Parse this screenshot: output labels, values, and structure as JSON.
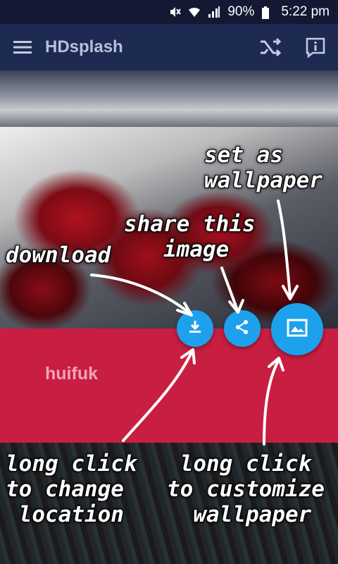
{
  "status_bar": {
    "battery": "90%",
    "time": "5:22 pm",
    "icons": [
      "mute-icon",
      "wifi-icon",
      "signal-icon",
      "battery-icon"
    ]
  },
  "app_bar": {
    "title": "HDsplash",
    "menu_icon": "hamburger-menu-icon",
    "actions": [
      "shuffle-icon",
      "info-icon"
    ]
  },
  "card": {
    "name": "huifuk",
    "color": "#c81e41"
  },
  "fabs": {
    "download_icon": "download-icon",
    "share_icon": "share-icon",
    "wallpaper_icon": "image-icon",
    "color": "#1da1ec"
  },
  "annotations": {
    "set_wallpaper": "set as\nwallpaper",
    "share": "share this\n   image",
    "download": "download",
    "long_click_location": "long click\nto change\n location",
    "long_click_customize": " long click\nto customize\n  wallpaper"
  }
}
